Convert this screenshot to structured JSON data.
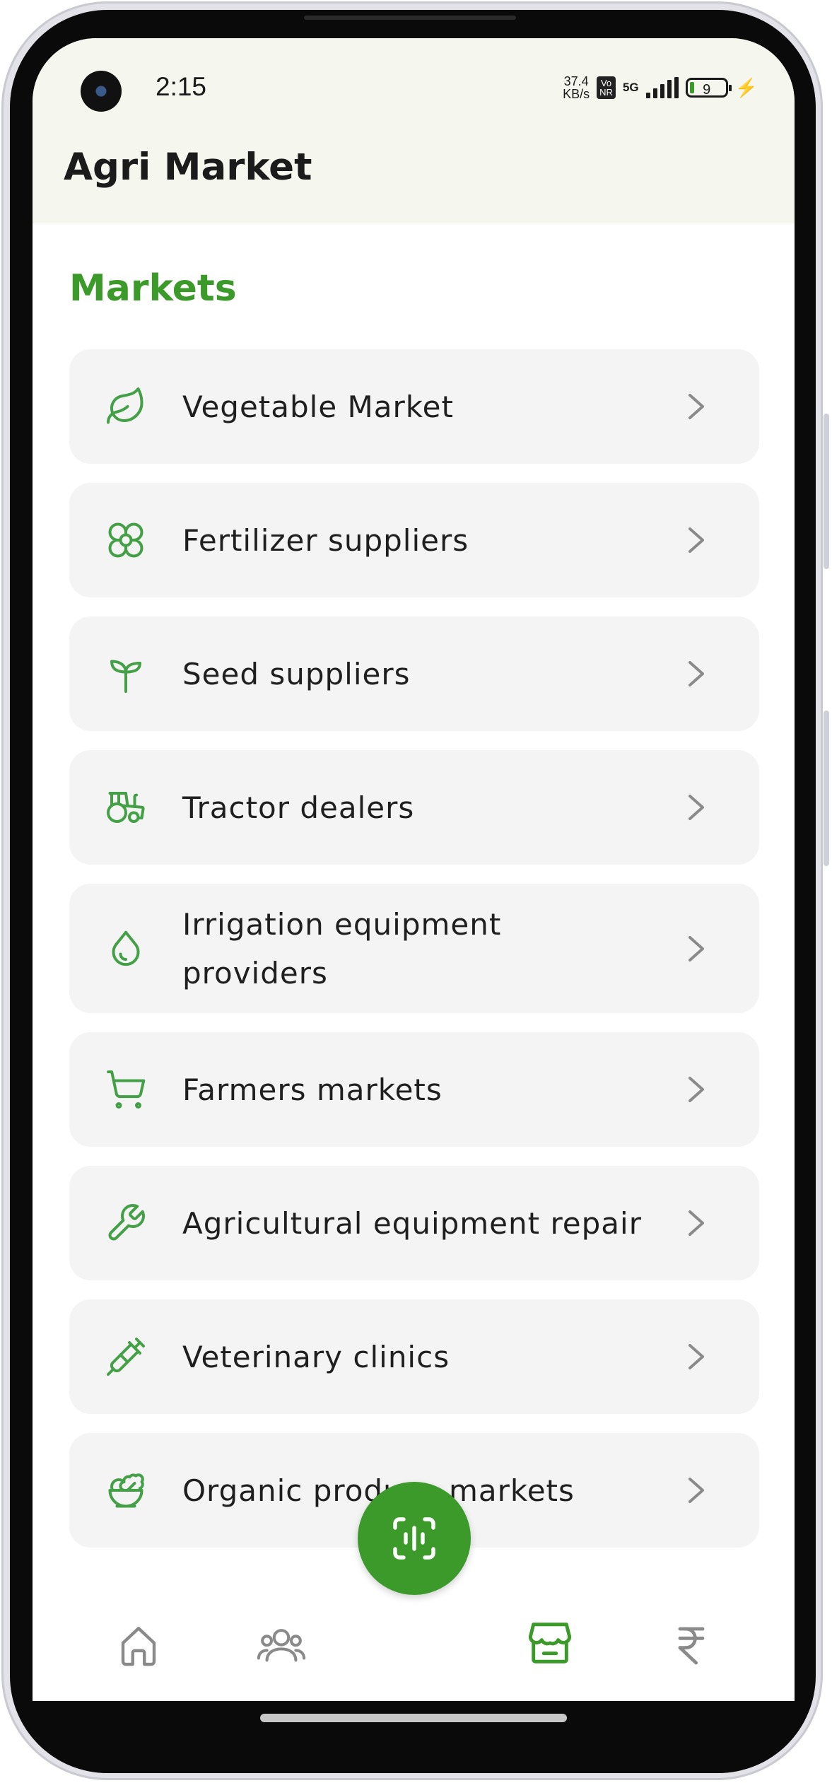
{
  "status_bar": {
    "time": "2:15",
    "net_speed_value": "37.4",
    "net_speed_unit": "KB/s",
    "volte_label_1": "Vo",
    "volte_label_2": "NR",
    "network": "5G",
    "battery_level": "9"
  },
  "header": {
    "title": "Agri Market"
  },
  "section": {
    "title": "Markets"
  },
  "markets": [
    {
      "label": "Vegetable Market",
      "icon": "leaf-icon"
    },
    {
      "label": "Fertilizer suppliers",
      "icon": "flower-icon"
    },
    {
      "label": "Seed suppliers",
      "icon": "sprout-icon"
    },
    {
      "label": "Tractor dealers",
      "icon": "tractor-icon"
    },
    {
      "label": "Irrigation equipment providers",
      "icon": "droplet-icon"
    },
    {
      "label": "Farmers markets",
      "icon": "shopping-cart-icon"
    },
    {
      "label": "Agricultural equipment repair",
      "icon": "wrench-icon"
    },
    {
      "label": "Veterinary clinics",
      "icon": "syringe-icon"
    },
    {
      "label": "Organic produce markets",
      "icon": "salad-bowl-icon"
    }
  ],
  "fab": {
    "icon": "voice-scan-icon"
  },
  "bottom_nav": [
    {
      "name": "home",
      "icon": "home-icon",
      "active": false
    },
    {
      "name": "community",
      "icon": "users-icon",
      "active": false
    },
    {
      "name": "market",
      "icon": "store-icon",
      "active": true
    },
    {
      "name": "finance",
      "icon": "rupee-icon",
      "active": false
    }
  ],
  "colors": {
    "accent": "#3c9a2a",
    "header_bg": "#f5f6ed",
    "card_bg": "#f4f4f4",
    "text": "#1f1f1f",
    "icon_green": "#43a047",
    "nav_inactive": "#8a8a8a"
  }
}
